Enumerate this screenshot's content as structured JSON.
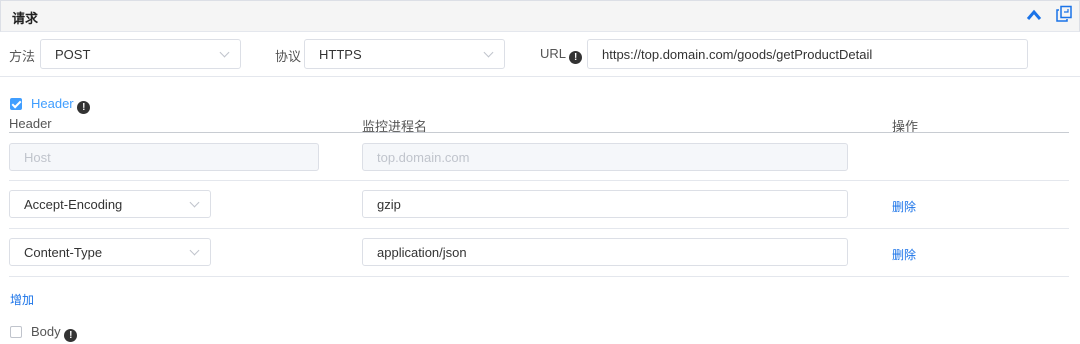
{
  "panel": {
    "title": "请求",
    "collapse_icon": "chevron-up-icon",
    "copy_icon": "copy-icon"
  },
  "request": {
    "method_label": "方法",
    "method_value": "POST",
    "protocol_label": "协议",
    "protocol_value": "HTTPS",
    "url_label": "URL",
    "url_value": "https://top.domain.com/goods/getProductDetail"
  },
  "header_section": {
    "toggle_label": "Header",
    "checked": true,
    "columns": [
      "Header",
      "监控进程名",
      "操作"
    ],
    "rows": [
      {
        "key": "Host",
        "value": "top.domain.com",
        "disabled": true,
        "action": ""
      },
      {
        "key": "Accept-Encoding",
        "value": "gzip",
        "disabled": false,
        "action": "删除"
      },
      {
        "key": "Content-Type",
        "value": "application/json",
        "disabled": false,
        "action": "删除"
      }
    ],
    "add_label": "增加"
  },
  "body_section": {
    "toggle_label": "Body",
    "checked": false
  },
  "colors": {
    "accent": "#409eff",
    "link": "#1a73e8",
    "border": "#dcdfe6"
  }
}
